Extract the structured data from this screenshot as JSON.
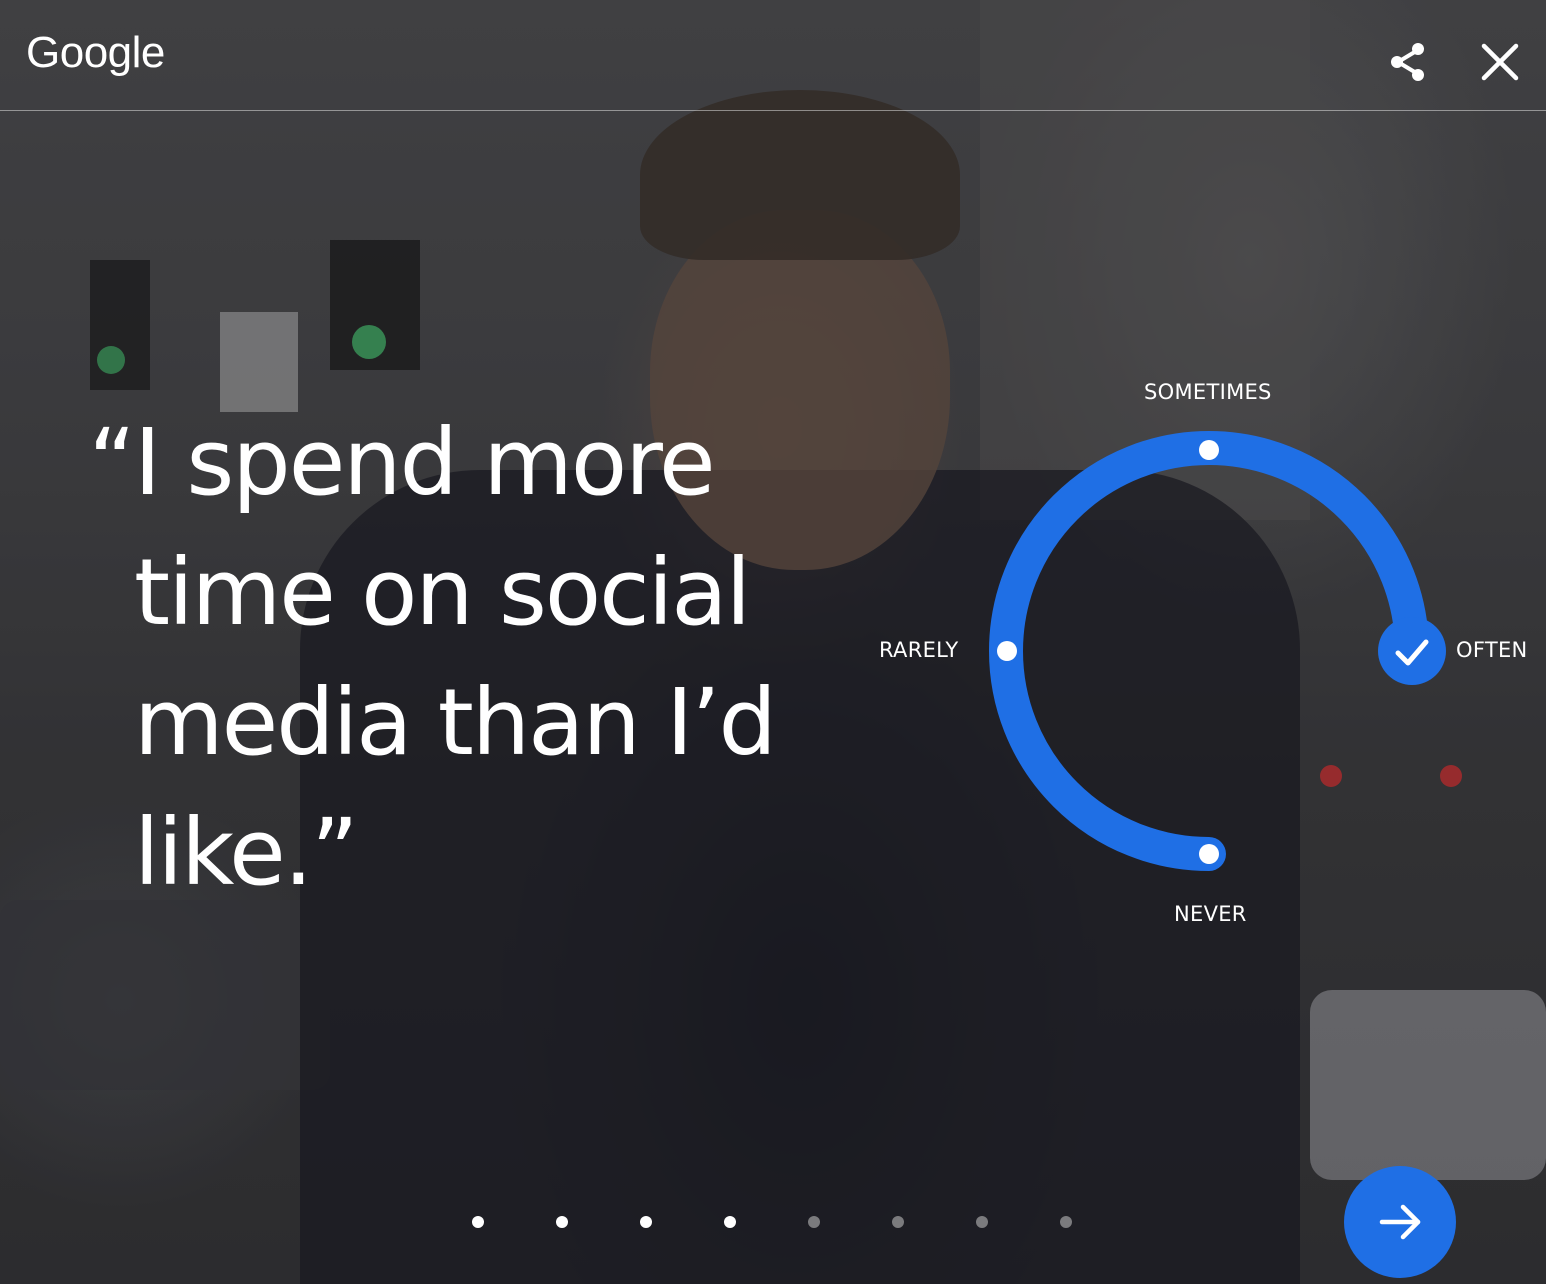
{
  "brand": {
    "logo_text": "Google"
  },
  "header": {
    "share_icon": "share-icon",
    "close_icon": "close-icon"
  },
  "question": {
    "open_quote": "“",
    "lines": [
      "I spend more",
      "time on social",
      "media than I’d",
      "like.”"
    ]
  },
  "answer_dial": {
    "options": [
      "NEVER",
      "RARELY",
      "SOMETIMES",
      "OFTEN"
    ],
    "selected": "OFTEN",
    "accent_color": "#1f6fe5",
    "check_icon": "check-icon"
  },
  "pagination": {
    "total": 8,
    "current": 4
  },
  "next_button": {
    "icon": "arrow-right-icon",
    "color": "#1f6fe5"
  }
}
